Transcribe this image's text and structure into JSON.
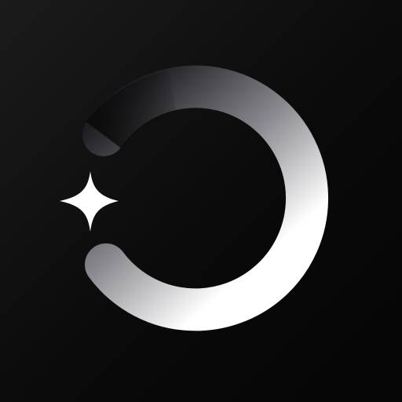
{
  "icon": {
    "name": "app-icon",
    "elements": [
      "crescent-ring-icon",
      "sparkle-star-icon"
    ]
  },
  "colors": {
    "background": "#0b0b0b",
    "ring_light": "#ffffff",
    "ring_mid": "#8a8a90",
    "ring_dark": "#1e1d22",
    "sparkle": "#ffffff"
  }
}
